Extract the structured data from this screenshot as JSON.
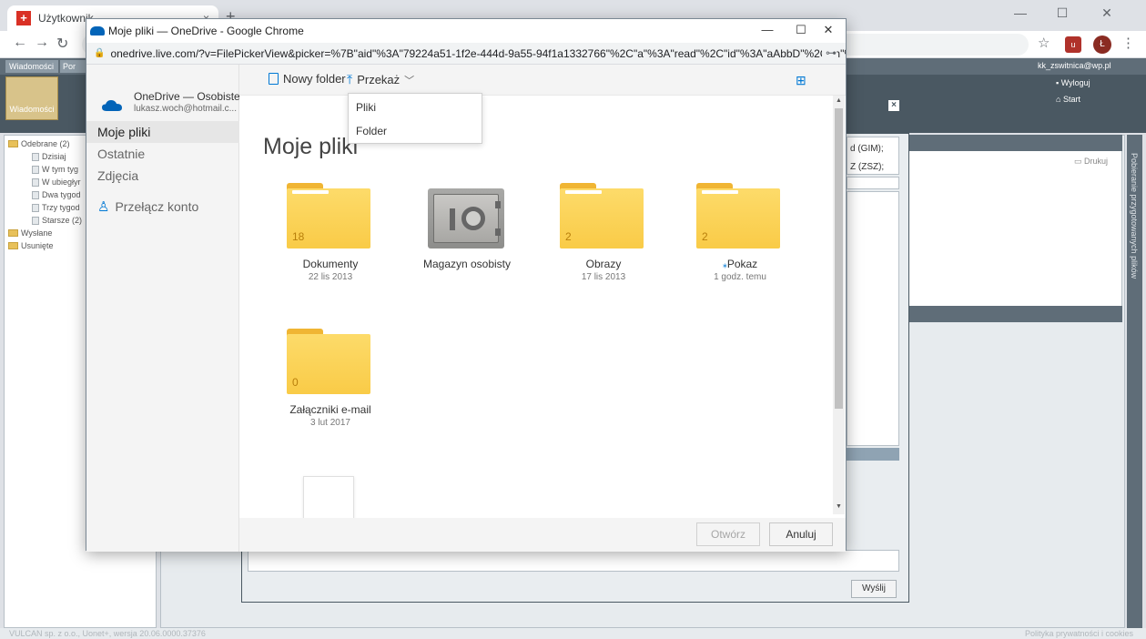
{
  "background_browser": {
    "tab_title": "Użytkownik",
    "tab_close": "×",
    "new_tab": "+",
    "window_controls": {
      "minimize": "—",
      "maximize": "☐",
      "close": "✕"
    }
  },
  "background_app": {
    "top_tabs": [
      "Wiadomości",
      "Por"
    ],
    "big_button_label": "Wiadomości",
    "user_email": "kk_zswitnica@wp.pl",
    "logout": "Wyloguj",
    "start": "Start",
    "tree": [
      {
        "label": "Odebrane (2)",
        "type": "folder"
      },
      {
        "label": "Dzisiaj",
        "type": "doc"
      },
      {
        "label": "W tym tyg",
        "type": "doc"
      },
      {
        "label": "W ubiegłyr",
        "type": "doc"
      },
      {
        "label": "Dwa tygod",
        "type": "doc"
      },
      {
        "label": "Trzy tygod",
        "type": "doc"
      },
      {
        "label": "Starsze (2)",
        "type": "doc"
      },
      {
        "label": "Wysłane",
        "type": "folder"
      },
      {
        "label": "Usunięte",
        "type": "folder"
      }
    ],
    "dialog_field_1": "d (GIM);",
    "dialog_field_2": "Z (ZSZ);",
    "drukuj": "Drukuj",
    "send_button": "Wyślij",
    "right_vertical_label": "Pobieranie przygotowanych plików",
    "footer_text": "VULCAN sp. z o.o., Uonet+, wersja 20.06.0000.37376",
    "footer_right": "Polityka prywatności i cookies"
  },
  "popup": {
    "window_title": "Moje pliki — OneDrive - Google Chrome",
    "url": "onedrive.live.com/?v=FilePickerView&picker=%7B\"aid\"%3A\"79224a51-1f2e-444d-9a55-94f1a1332766\"%2C\"a\"%3A\"read\"%2C\"id\"%3A\"aAbbD\"%2C\"ln\"%...",
    "window_controls": {
      "minimize": "—",
      "maximize": "☐",
      "close": "✕"
    },
    "nav": {
      "brand_title": "OneDrive — Osobiste",
      "brand_email": "lukasz.woch@hotmail.c...",
      "items": [
        "Moje pliki",
        "Ostatnie",
        "Zdjęcia"
      ],
      "switch_account": "Przełącz konto"
    },
    "command_bar": {
      "new_folder": "Nowy folder",
      "upload": "Przekaż",
      "upload_menu": [
        "Pliki",
        "Folder"
      ]
    },
    "heading": "Moje pliki",
    "tiles": [
      {
        "name": "Dokumenty",
        "date": "22 lis 2013",
        "count": "18",
        "kind": "folder"
      },
      {
        "name": "Magazyn osobisty",
        "date": "",
        "count": "",
        "kind": "vault"
      },
      {
        "name": "Obrazy",
        "date": "17 lis 2013",
        "count": "2",
        "kind": "folder"
      },
      {
        "name": "Pokaz",
        "date": "1 godz. temu",
        "count": "2",
        "kind": "folder"
      },
      {
        "name": "Załączniki e-mail",
        "date": "3 lut 2017",
        "count": "0",
        "kind": "folder"
      }
    ],
    "footer": {
      "open": "Otwórz",
      "cancel": "Anuluj"
    }
  }
}
